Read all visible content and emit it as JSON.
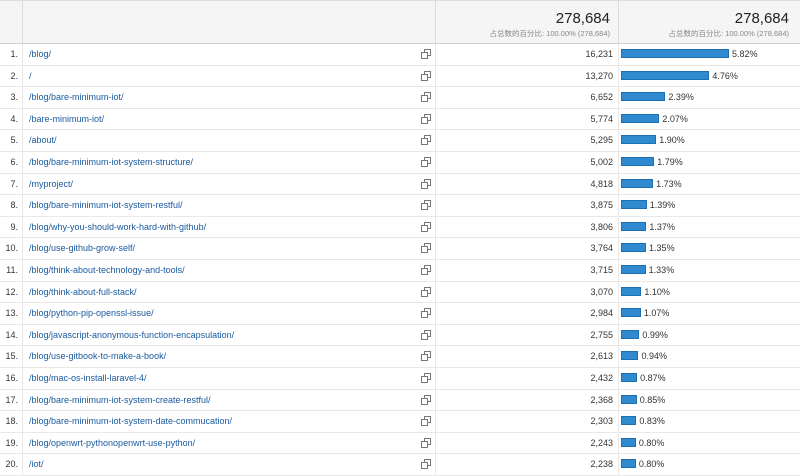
{
  "header": {
    "total_value": "278,684",
    "total_pct_label": "占总数的百分比: 100.00% (278,684)",
    "share_total_value": "278,684",
    "share_pct_label": "占总数的百分比: 100.00% (278,684)"
  },
  "rows": [
    {
      "index": "1.",
      "page": "/blog/",
      "views": "16,231",
      "percent": "5.82%",
      "share": 5.82
    },
    {
      "index": "2.",
      "page": "/",
      "views": "13,270",
      "percent": "4.76%",
      "share": 4.76
    },
    {
      "index": "3.",
      "page": "/blog/bare-minimum-iot/",
      "views": "6,652",
      "percent": "2.39%",
      "share": 2.39
    },
    {
      "index": "4.",
      "page": "/bare-minimum-iot/",
      "views": "5,774",
      "percent": "2.07%",
      "share": 2.07
    },
    {
      "index": "5.",
      "page": "/about/",
      "views": "5,295",
      "percent": "1.90%",
      "share": 1.9
    },
    {
      "index": "6.",
      "page": "/blog/bare-minimum-iot-system-structure/",
      "views": "5,002",
      "percent": "1.79%",
      "share": 1.79
    },
    {
      "index": "7.",
      "page": "/myproject/",
      "views": "4,818",
      "percent": "1.73%",
      "share": 1.73
    },
    {
      "index": "8.",
      "page": "/blog/bare-minimum-iot-system-restful/",
      "views": "3,875",
      "percent": "1.39%",
      "share": 1.39
    },
    {
      "index": "9.",
      "page": "/blog/why-you-should-work-hard-with-github/",
      "views": "3,806",
      "percent": "1.37%",
      "share": 1.37
    },
    {
      "index": "10.",
      "page": "/blog/use-github-grow-self/",
      "views": "3,764",
      "percent": "1.35%",
      "share": 1.35
    },
    {
      "index": "11.",
      "page": "/blog/think-about-technology-and-tools/",
      "views": "3,715",
      "percent": "1.33%",
      "share": 1.33
    },
    {
      "index": "12.",
      "page": "/blog/think-about-full-stack/",
      "views": "3,070",
      "percent": "1.10%",
      "share": 1.1
    },
    {
      "index": "13.",
      "page": "/blog/python-pip-openssl-issue/",
      "views": "2,984",
      "percent": "1.07%",
      "share": 1.07
    },
    {
      "index": "14.",
      "page": "/blog/javascript-anonymous-function-encapsulation/",
      "views": "2,755",
      "percent": "0.99%",
      "share": 0.99
    },
    {
      "index": "15.",
      "page": "/blog/use-gitbook-to-make-a-book/",
      "views": "2,613",
      "percent": "0.94%",
      "share": 0.94
    },
    {
      "index": "16.",
      "page": "/blog/mac-os-install-laravel-4/",
      "views": "2,432",
      "percent": "0.87%",
      "share": 0.87
    },
    {
      "index": "17.",
      "page": "/blog/bare-minimum-iot-system-create-restful/",
      "views": "2,368",
      "percent": "0.85%",
      "share": 0.85
    },
    {
      "index": "18.",
      "page": "/blog/bare-minimum-iot-system-date-commucation/",
      "views": "2,303",
      "percent": "0.83%",
      "share": 0.83
    },
    {
      "index": "19.",
      "page": "/blog/openwrt-pythonopenwrt-use-python/",
      "views": "2,243",
      "percent": "0.80%",
      "share": 0.8
    },
    {
      "index": "20.",
      "page": "/iot/",
      "views": "2,238",
      "percent": "0.80%",
      "share": 0.8
    }
  ],
  "colors": {
    "bar_fill": "#2f8ad0",
    "link": "#1a5aa0"
  },
  "icons": {
    "row_action": "open-in-new-window-icon"
  }
}
